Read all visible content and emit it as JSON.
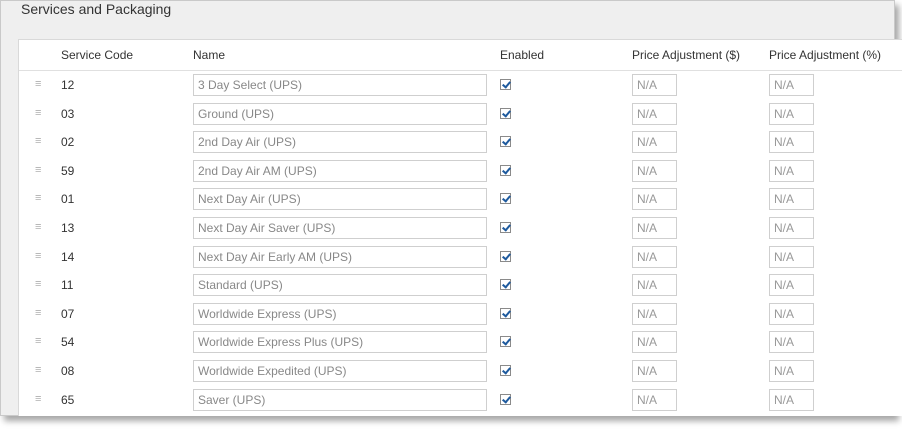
{
  "section_title": "Services and Packaging",
  "columns": {
    "service_code": "Service Code",
    "name": "Name",
    "enabled": "Enabled",
    "price_adj_dollar": "Price Adjustment ($)",
    "price_adj_percent": "Price Adjustment (%)"
  },
  "handle_glyph": "≡",
  "rows": [
    {
      "code": "12",
      "name": "3 Day Select (UPS)",
      "enabled": true,
      "adj_dollar": "N/A",
      "adj_percent": "N/A"
    },
    {
      "code": "03",
      "name": "Ground (UPS)",
      "enabled": true,
      "adj_dollar": "N/A",
      "adj_percent": "N/A"
    },
    {
      "code": "02",
      "name": "2nd Day Air (UPS)",
      "enabled": true,
      "adj_dollar": "N/A",
      "adj_percent": "N/A"
    },
    {
      "code": "59",
      "name": "2nd Day Air AM (UPS)",
      "enabled": true,
      "adj_dollar": "N/A",
      "adj_percent": "N/A"
    },
    {
      "code": "01",
      "name": "Next Day Air (UPS)",
      "enabled": true,
      "adj_dollar": "N/A",
      "adj_percent": "N/A"
    },
    {
      "code": "13",
      "name": "Next Day Air Saver (UPS)",
      "enabled": true,
      "adj_dollar": "N/A",
      "adj_percent": "N/A"
    },
    {
      "code": "14",
      "name": "Next Day Air Early AM (UPS)",
      "enabled": true,
      "adj_dollar": "N/A",
      "adj_percent": "N/A"
    },
    {
      "code": "11",
      "name": "Standard (UPS)",
      "enabled": true,
      "adj_dollar": "N/A",
      "adj_percent": "N/A"
    },
    {
      "code": "07",
      "name": "Worldwide Express (UPS)",
      "enabled": true,
      "adj_dollar": "N/A",
      "adj_percent": "N/A"
    },
    {
      "code": "54",
      "name": "Worldwide Express Plus (UPS)",
      "enabled": true,
      "adj_dollar": "N/A",
      "adj_percent": "N/A"
    },
    {
      "code": "08",
      "name": "Worldwide Expedited (UPS)",
      "enabled": true,
      "adj_dollar": "N/A",
      "adj_percent": "N/A"
    },
    {
      "code": "65",
      "name": "Saver (UPS)",
      "enabled": true,
      "adj_dollar": "N/A",
      "adj_percent": "N/A"
    }
  ]
}
